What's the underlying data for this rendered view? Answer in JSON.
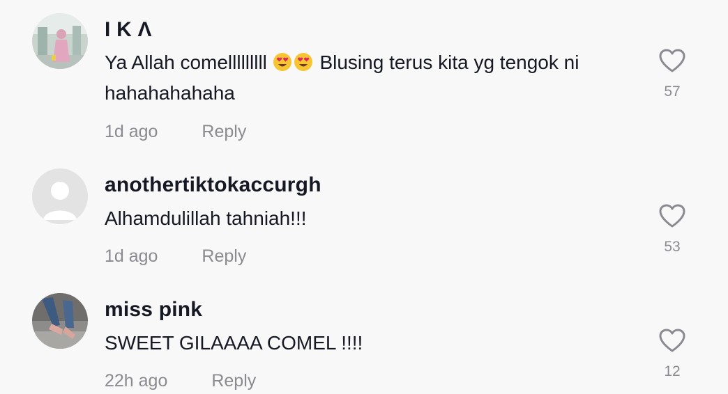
{
  "comments": [
    {
      "username": "I K Λ",
      "text_before": "Ya Allah comelllllllll",
      "text_after": " Blusing terus kita yg tengok ni hahahahahaha",
      "emojis": [
        "heart-eyes-emoji",
        "heart-eyes-emoji"
      ],
      "time": "1d ago",
      "reply_label": "Reply",
      "likes": "57",
      "avatar": "photo-avatar-woman-pink"
    },
    {
      "username": "anothertiktokaccurgh",
      "text": "Alhamdulillah tahniah!!!",
      "time": "1d ago",
      "reply_label": "Reply",
      "likes": "53",
      "avatar": "default-avatar"
    },
    {
      "username": "miss pink",
      "text": "SWEET GILAAAA COMEL !!!!",
      "time": "22h ago",
      "reply_label": "Reply",
      "likes": "12",
      "avatar": "photo-avatar-legs-heels"
    }
  ],
  "colors": {
    "background": "#f8f8f8",
    "primary_text": "#161823",
    "secondary_text": "#8a8b91",
    "icon": "#8a8b91"
  }
}
